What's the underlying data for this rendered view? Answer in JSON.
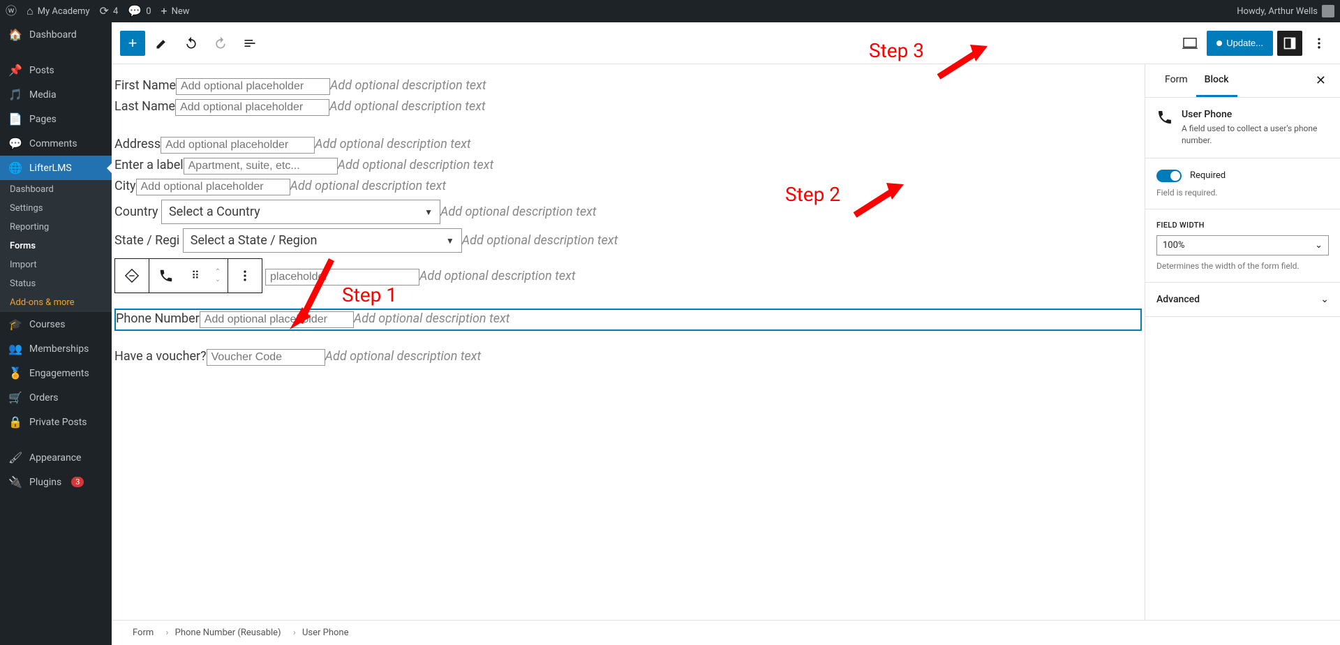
{
  "adminbar": {
    "site_name": "My Academy",
    "update_count": "4",
    "comment_count": "0",
    "new_label": "New",
    "howdy": "Howdy, Arthur Wells"
  },
  "sidebar": {
    "items": [
      {
        "label": "Dashboard",
        "icon": "dashboard"
      },
      {
        "label": "Posts",
        "icon": "pin"
      },
      {
        "label": "Media",
        "icon": "media"
      },
      {
        "label": "Pages",
        "icon": "page"
      },
      {
        "label": "Comments",
        "icon": "comment"
      },
      {
        "label": "LifterLMS",
        "icon": "globe"
      },
      {
        "label": "Courses",
        "icon": "grad"
      },
      {
        "label": "Memberships",
        "icon": "groups"
      },
      {
        "label": "Engagements",
        "icon": "award"
      },
      {
        "label": "Orders",
        "icon": "cart"
      },
      {
        "label": "Private Posts",
        "icon": "lock"
      },
      {
        "label": "Appearance",
        "icon": "brush"
      },
      {
        "label": "Plugins",
        "icon": "plug",
        "badge": "3"
      }
    ],
    "submenu": [
      "Dashboard",
      "Settings",
      "Reporting",
      "Forms",
      "Import",
      "Status",
      "Add-ons & more"
    ]
  },
  "topbar": {
    "update_label": "Update..."
  },
  "form_fields": {
    "first_name": {
      "label": "First Name",
      "placeholder": "Add optional placeholder",
      "desc": "Add optional description text"
    },
    "last_name": {
      "label": "Last Name",
      "placeholder": "Add optional placeholder",
      "desc": "Add optional description text"
    },
    "address": {
      "label": "Address",
      "placeholder": "Add optional placeholder",
      "desc": "Add optional description text"
    },
    "address2": {
      "label": "Enter a label",
      "placeholder": "Apartment, suite, etc...",
      "desc": "Add optional description text"
    },
    "city": {
      "label": "City",
      "placeholder": "Add optional placeholder",
      "desc": "Add optional description text"
    },
    "country": {
      "label": "Country",
      "select": "Select a Country",
      "desc": "Add optional description text"
    },
    "state": {
      "label": "State / Regi",
      "select": "Select a State / Region",
      "desc": "Add optional description text"
    },
    "zip": {
      "placeholder": "placeholder",
      "desc": "Add optional description text"
    },
    "phone": {
      "label": "Phone Number",
      "placeholder": "Add optional placeholder",
      "desc": "Add optional description text"
    },
    "voucher": {
      "label": "Have a voucher?",
      "placeholder": "Voucher Code",
      "desc": "Add optional description text"
    }
  },
  "breadcrumb": {
    "items": [
      "Form",
      "Phone Number (Reusable)",
      "User Phone"
    ]
  },
  "settings": {
    "tab_form": "Form",
    "tab_block": "Block",
    "block_title": "User Phone",
    "block_desc": "A field used to collect a user's phone number.",
    "required_label": "Required",
    "required_help": "Field is required.",
    "field_width_label": "FIELD WIDTH",
    "field_width_value": "100%",
    "field_width_help": "Determines the width of the form field.",
    "advanced_label": "Advanced"
  },
  "annotations": {
    "step1": "Step 1",
    "step2": "Step 2",
    "step3": "Step 3"
  }
}
